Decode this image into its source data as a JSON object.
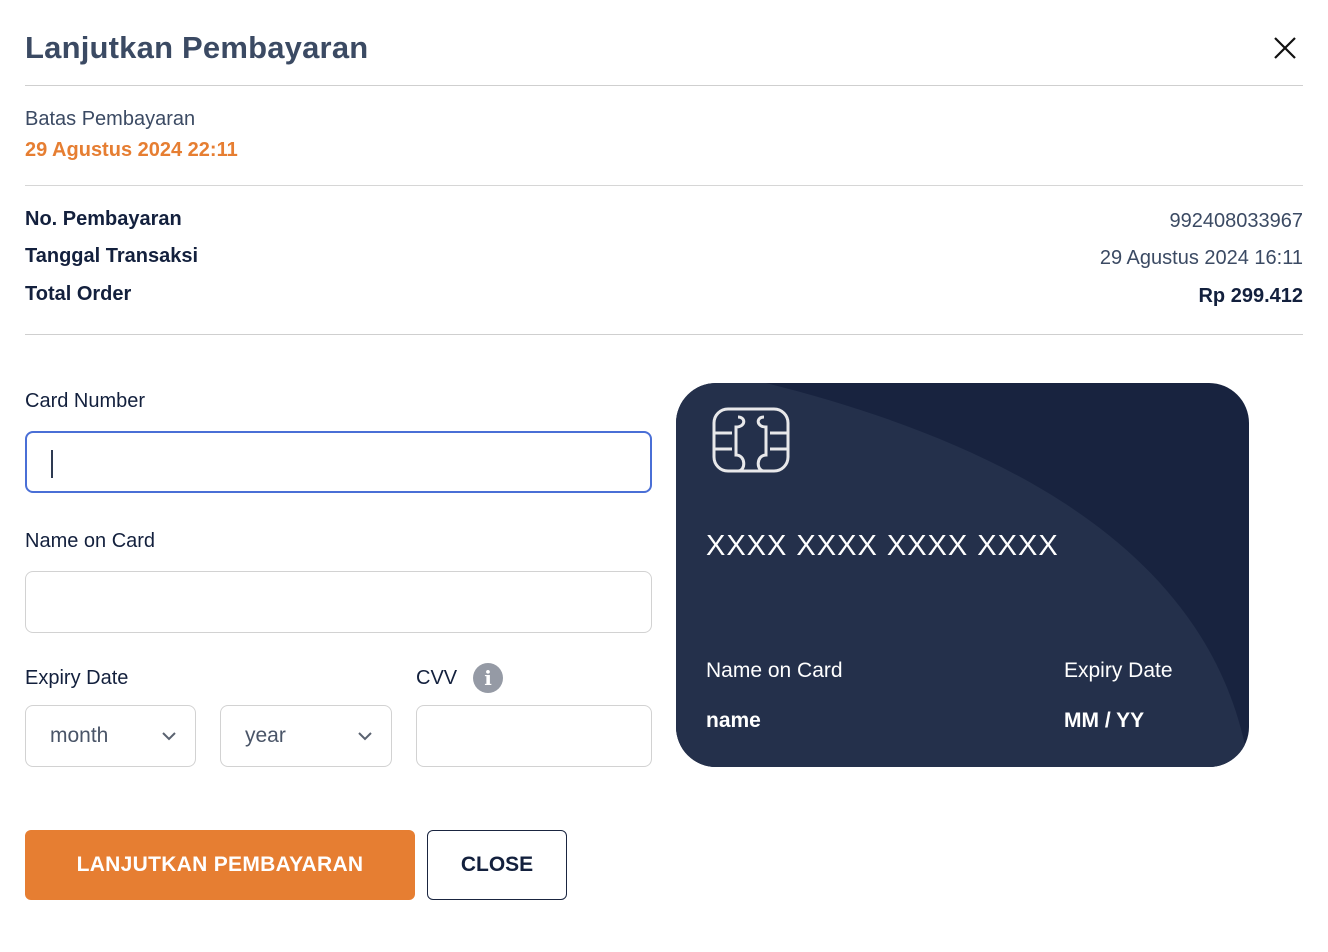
{
  "dialog": {
    "title": "Lanjutkan Pembayaran",
    "close_icon": "close-icon"
  },
  "deadline": {
    "label": "Batas Pembayaran",
    "value": "29 Agustus 2024 22:11"
  },
  "details": [
    {
      "label": "No. Pembayaran",
      "value": "992408033967"
    },
    {
      "label": "Tanggal Transaksi",
      "value": "29 Agustus 2024 16:11"
    },
    {
      "label": "Total Order",
      "value": "Rp 299.412"
    }
  ],
  "form": {
    "card_number": {
      "label": "Card Number",
      "value": "",
      "placeholder": ""
    },
    "name_on_card": {
      "label": "Name on Card",
      "value": "",
      "placeholder": ""
    },
    "expiry": {
      "label": "Expiry Date",
      "month_selected": "month",
      "year_selected": "year"
    },
    "cvv": {
      "label": "CVV",
      "value": "",
      "info_icon": "i"
    }
  },
  "card_preview": {
    "number": "XXXX XXXX XXXX XXXX",
    "name_label": "Name on Card",
    "name_value": "name",
    "expiry_label": "Expiry Date",
    "expiry_value": "MM / YY"
  },
  "buttons": {
    "primary": "LANJUTKAN PEMBAYARAN",
    "secondary": "CLOSE"
  },
  "colors": {
    "accent": "#e67e32",
    "card_bg": "#18233f",
    "card_curve": "#24304b",
    "focus": "#4a6fd6"
  }
}
